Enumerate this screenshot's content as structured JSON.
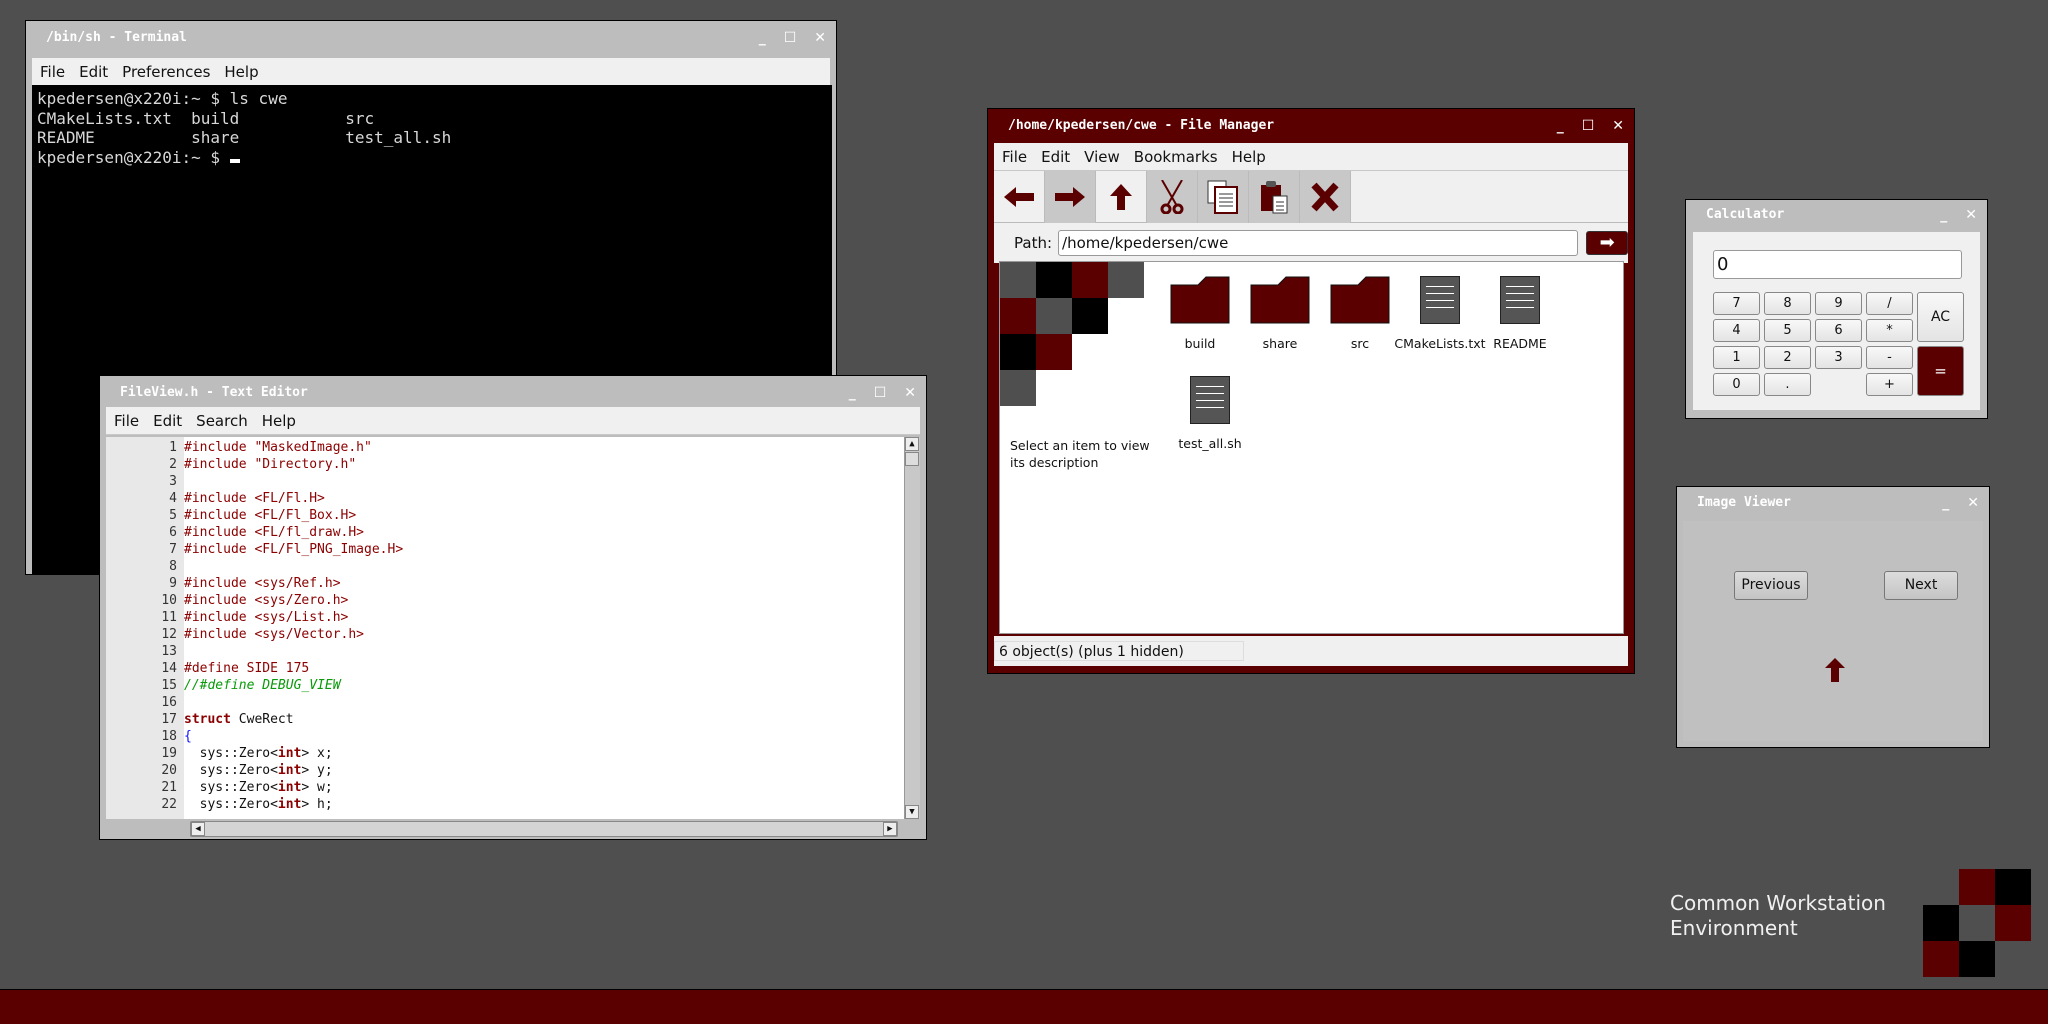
{
  "terminal": {
    "title": "/bin/sh - Terminal",
    "menu": [
      "File",
      "Edit",
      "Preferences",
      "Help"
    ],
    "lines": [
      "kpedersen@x220i:~ $ ls cwe",
      "CMakeLists.txt  build           src",
      "README          share           test_all.sh",
      "kpedersen@x220i:~ $ "
    ]
  },
  "editor": {
    "title": "FileView.h - Text Editor",
    "menu": [
      "File",
      "Edit",
      "Search",
      "Help"
    ],
    "lines": [
      [
        [
          "#include \"MaskedImage.h\"",
          "pre"
        ]
      ],
      [
        [
          "#include \"Directory.h\"",
          "pre"
        ]
      ],
      [],
      [
        [
          "#include <FL/Fl.H>",
          "pre"
        ]
      ],
      [
        [
          "#include <FL/Fl_Box.H>",
          "pre"
        ]
      ],
      [
        [
          "#include <FL/fl_draw.H>",
          "pre"
        ]
      ],
      [
        [
          "#include <FL/Fl_PNG_Image.H>",
          "pre"
        ]
      ],
      [],
      [
        [
          "#include <sys/Ref.h>",
          "pre"
        ]
      ],
      [
        [
          "#include <sys/Zero.h>",
          "pre"
        ]
      ],
      [
        [
          "#include <sys/List.h>",
          "pre"
        ]
      ],
      [
        [
          "#include <sys/Vector.h>",
          "pre"
        ]
      ],
      [],
      [
        [
          "#define SIDE 175",
          "pre"
        ]
      ],
      [
        [
          "//#define DEBUG_VIEW",
          "com"
        ]
      ],
      [],
      [
        [
          "struct",
          "kw"
        ],
        [
          " CweRect",
          "n"
        ]
      ],
      [
        [
          "{",
          "br"
        ]
      ],
      [
        [
          "  sys::Zero<",
          "n"
        ],
        [
          "int",
          "kw"
        ],
        [
          "> x;",
          "n"
        ]
      ],
      [
        [
          "  sys::Zero<",
          "n"
        ],
        [
          "int",
          "kw"
        ],
        [
          "> y;",
          "n"
        ]
      ],
      [
        [
          "  sys::Zero<",
          "n"
        ],
        [
          "int",
          "kw"
        ],
        [
          "> w;",
          "n"
        ]
      ],
      [
        [
          "  sys::Zero<",
          "n"
        ],
        [
          "int",
          "kw"
        ],
        [
          "> h;",
          "n"
        ]
      ]
    ]
  },
  "filemanager": {
    "title": "/home/kpedersen/cwe - File Manager",
    "menu": [
      "File",
      "Edit",
      "View",
      "Bookmarks",
      "Help"
    ],
    "toolbar": [
      "back-icon",
      "forward-icon",
      "up-icon",
      "cut-icon",
      "copy-icon",
      "paste-icon",
      "delete-icon"
    ],
    "path_label": "Path:",
    "path_value": "/home/kpedersen/cwe",
    "description": "Select an item to view its description",
    "items": [
      {
        "name": "build",
        "type": "folder"
      },
      {
        "name": "share",
        "type": "folder"
      },
      {
        "name": "src",
        "type": "folder"
      },
      {
        "name": "CMakeLists.txt",
        "type": "file"
      },
      {
        "name": "README",
        "type": "file"
      },
      {
        "name": "test_all.sh",
        "type": "file"
      }
    ],
    "status": "6 object(s) (plus 1 hidden)"
  },
  "calculator": {
    "title": "Calculator",
    "display": "0",
    "keys": [
      "7",
      "8",
      "9",
      "/",
      "4",
      "5",
      "6",
      "*",
      "1",
      "2",
      "3",
      "-",
      "0",
      ".",
      "+"
    ],
    "clear": "AC",
    "equals": "="
  },
  "imageviewer": {
    "title": "Image Viewer",
    "previous": "Previous",
    "next": "Next"
  },
  "desktop": {
    "brand_line1": "Common Workstation",
    "brand_line2": "Environment"
  },
  "colors": {
    "accent": "#5a0000",
    "background": "#4f4f4f",
    "chrome": "#bdbdbd"
  }
}
